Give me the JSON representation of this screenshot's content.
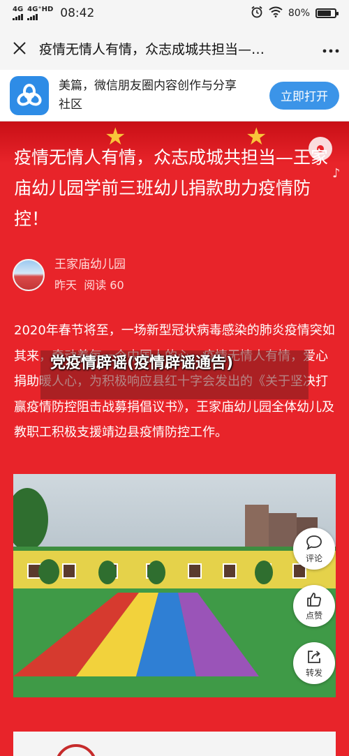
{
  "status_bar": {
    "network1": "4G",
    "network2": "4G⁺HD",
    "time": "08:42",
    "battery": "80%",
    "battery_level": 0.8
  },
  "nav": {
    "title": "疫情无情人有情，众志成城共担当—…"
  },
  "banner": {
    "text": "美篇，微信朋友圈内容创作与分享社区",
    "open_button": "立即打开"
  },
  "article": {
    "title": "疫情无情人有情，众志成城共担当—王家庙幼儿园学前三班幼儿捐款助力疫情防控！",
    "author": "王家庙幼儿园",
    "date": "昨天",
    "reads": "阅读 60",
    "body": "2020年春节将至，一场新型冠状病毒感染的肺炎疫情突如其来，牵动着每一个中国人的心。疫情无情人有情，爱心捐助暖人心，为积极响应县红十字会发出的《关于坚决打赢疫情防控阻击战募捐倡议书》，王家庙幼儿园全体幼儿及教职工积极支援靖边县疫情防控工作。"
  },
  "overlay": {
    "text": "党疫情辟谣(疫情辟谣通告)"
  },
  "actions": {
    "comment": "评论",
    "like": "点赞",
    "share": "转发"
  },
  "icons": {
    "close": "close-icon",
    "more": "more-icon",
    "app_logo": "meipian-logo-icon",
    "music": "music-disc-icon",
    "comment": "comment-icon",
    "like": "thumbs-up-icon",
    "share": "share-icon"
  },
  "colors": {
    "article_bg": "#e8242a",
    "accent_blue": "#3b94e8"
  }
}
